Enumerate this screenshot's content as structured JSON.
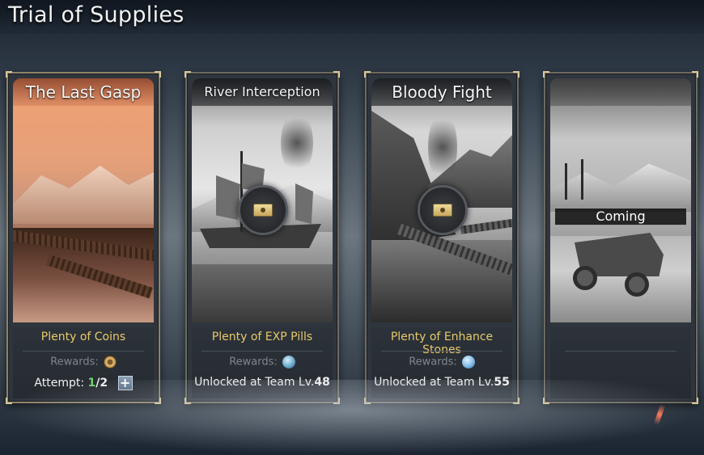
{
  "page": {
    "title": "Trial of Supplies"
  },
  "cards": [
    {
      "title": "The Last Gasp",
      "reward_name": "Plenty of Coins",
      "rewards_label": "Rewards:",
      "reward_icon": "coin-icon",
      "attempt_label": "Attempt:",
      "attempt_used": "1",
      "attempt_sep": "/",
      "attempt_total": "2",
      "plus_label": "+",
      "locked": false
    },
    {
      "title": "River Interception",
      "reward_name": "Plenty of EXP Pills",
      "rewards_label": "Rewards:",
      "reward_icon": "exp-pill-icon",
      "unlock_label": "Unlocked at Team Lv.",
      "unlock_level": "48",
      "locked": true
    },
    {
      "title": "Bloody Fight",
      "reward_name": "Plenty of Enhance Stones",
      "rewards_label": "Rewards:",
      "reward_icon": "enhance-stone-icon",
      "unlock_label": "Unlocked at Team Lv.",
      "unlock_level": "55",
      "locked": true
    },
    {
      "title": "",
      "overlay_text": "Coming",
      "locked": true
    }
  ],
  "colors": {
    "reward_name": "#e8c96a",
    "attempt_used": "#6fd36b",
    "card_border": "#8e8368"
  }
}
